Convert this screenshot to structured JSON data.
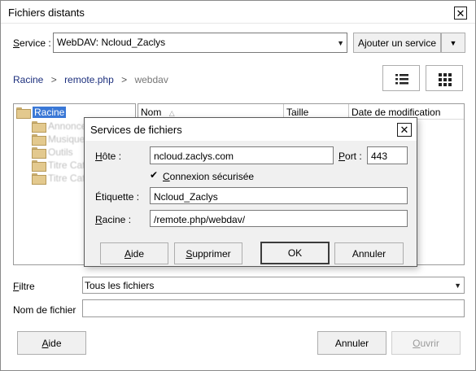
{
  "window": {
    "title": "Fichiers distants"
  },
  "service": {
    "label": "Service :",
    "value": "WebDAV: Ncloud_Zaclys",
    "add_button": "Ajouter un service"
  },
  "breadcrumb": [
    "Racine",
    "remote.php",
    "webdav"
  ],
  "breadcrumb_sep": ">",
  "tree": {
    "root": "Racine",
    "children": [
      "Annonces",
      "Musique",
      "Outils",
      "Titre Cat",
      "Titre Cat"
    ]
  },
  "columns": [
    "Nom",
    "Taille",
    "Date de modification"
  ],
  "filter": {
    "label": "Filtre",
    "value": "Tous les fichiers"
  },
  "filename": {
    "label": "Nom de fichier",
    "value": ""
  },
  "buttons": {
    "help": "Aide",
    "cancel": "Annuler",
    "open": "Ouvrir"
  },
  "dialog": {
    "title": "Services de fichiers",
    "host_label": "Hôte :",
    "host_value": "ncloud.zaclys.com",
    "port_label": "Port :",
    "port_value": "443",
    "secure_label": "Connexion sécurisée",
    "secure_checked": true,
    "tag_label": "Étiquette :",
    "tag_value": "Ncloud_Zaclys",
    "root_label": "Racine :",
    "root_value": "/remote.php/webdav/",
    "help": "Aide",
    "delete": "Supprimer",
    "ok": "OK",
    "cancel": "Annuler"
  },
  "icons": {
    "close": "close-icon",
    "dropdown": "chevron-down-icon",
    "list_view": "list-view-icon",
    "grid_view": "grid-view-icon",
    "folder": "folder-icon",
    "sort": "sort-up-icon",
    "check": "checkmark-icon"
  }
}
